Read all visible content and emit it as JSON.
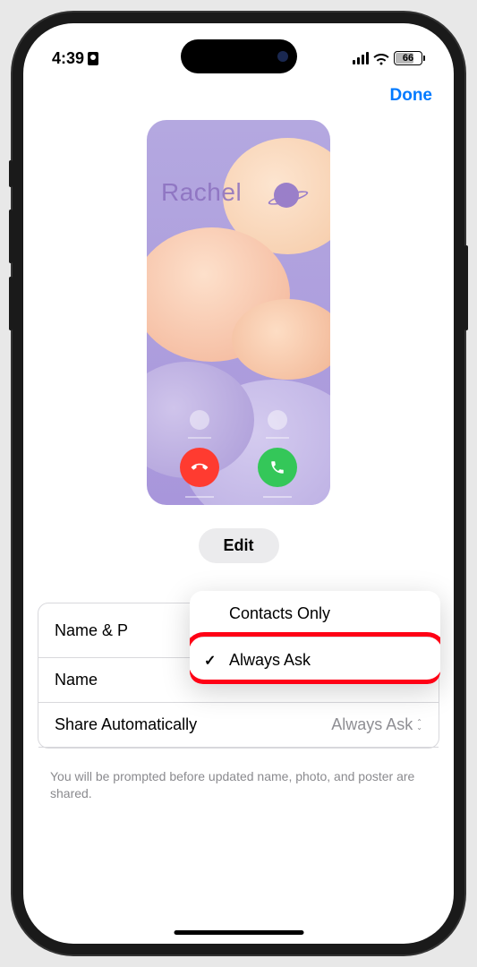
{
  "status": {
    "time": "4:39",
    "battery_pct": "66"
  },
  "nav": {
    "done": "Done"
  },
  "poster": {
    "name": "Rachel",
    "edit_label": "Edit"
  },
  "settings": {
    "row1_label": "Name & P",
    "row2_label": "Name",
    "row3_label": "Share Automatically",
    "row3_value": "Always Ask",
    "footer": "You will be prompted before updated name, photo, and poster are shared."
  },
  "menu": {
    "opt1": "Contacts Only",
    "opt2": "Always Ask"
  }
}
